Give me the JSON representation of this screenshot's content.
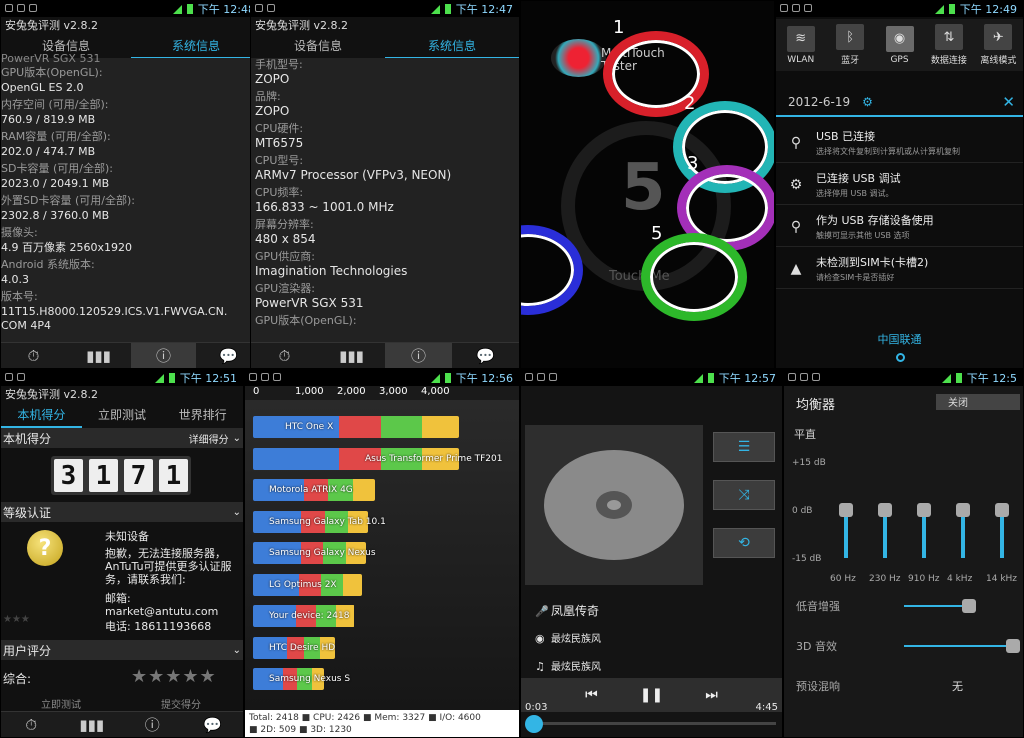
{
  "panel1": {
    "time": "下午 12:48",
    "app_title": "安兔兔评测 v2.8.2",
    "tabs": [
      "设备信息",
      "系统信息"
    ],
    "rows": [
      {
        "label": "GPU版本(OpenGL):",
        "value": "OpenGL ES 2.0"
      },
      {
        "label": "内存空间 (可用/全部):",
        "value": "760.9 / 819.9 MB"
      },
      {
        "label": "RAM容量 (可用/全部):",
        "value": "202.0 / 474.7 MB"
      },
      {
        "label": "SD卡容量 (可用/全部):",
        "value": "2023.0 / 2049.1 MB"
      },
      {
        "label": "外置SD卡容量 (可用/全部):",
        "value": "2302.8 / 3760.0 MB"
      },
      {
        "label": "摄像头:",
        "value": "4.9 百万像素    2560x1920"
      },
      {
        "label": "Android 系统版本:",
        "value": "4.0.3"
      },
      {
        "label": "版本号:",
        "value": "11T15.H8000.120529.ICS.V1.FWVGA.CN."
      }
    ],
    "top_clip": "PowerVR SGX 531",
    "bottom_clip": "COM 4P4"
  },
  "panel2": {
    "time": "下午 12:47",
    "app_title": "安兔兔评测 v2.8.2",
    "tabs": [
      "设备信息",
      "系统信息"
    ],
    "rows": [
      {
        "label": "手机型号:",
        "value": "ZOPO"
      },
      {
        "label": "品牌:",
        "value": "ZOPO"
      },
      {
        "label": "CPU硬件:",
        "value": "MT6575"
      },
      {
        "label": "CPU型号:",
        "value": "ARMv7 Processor (VFPv3, NEON)"
      },
      {
        "label": "CPU频率:",
        "value": "166.833 ~ 1001.0 MHz"
      },
      {
        "label": "屏幕分辨率:",
        "value": "480 x 854"
      },
      {
        "label": "GPU供应商:",
        "value": "Imagination Technologies"
      },
      {
        "label": "GPU渲染器:",
        "value": "PowerVR SGX 531"
      },
      {
        "label": "GPU版本(OpenGL):",
        "value": ""
      }
    ]
  },
  "panel3": {
    "logo": "MultiTouch Tester",
    "big_count": "5",
    "touch_label": "Touch Me",
    "labels": [
      "1",
      "2",
      "3",
      "5"
    ]
  },
  "panel4": {
    "time": "下午 12:49",
    "quick": [
      "WLAN",
      "蓝牙",
      "GPS",
      "数据连接",
      "离线模式"
    ],
    "date": "2012-6-19",
    "notifications": [
      {
        "title": "USB 已连接",
        "sub": "选择将文件复制到计算机或从计算机复制"
      },
      {
        "title": "已连接 USB 调试",
        "sub": "选择停用 USB 调试。"
      },
      {
        "title": "作为 USB 存储设备使用",
        "sub": "触摸可显示其他 USB 选项"
      },
      {
        "title": "未检测到SIM卡(卡槽2)",
        "sub": "请检查SIM卡是否插好"
      }
    ],
    "carrier": "中国联通"
  },
  "panel5": {
    "time": "下午 12:51",
    "app_title": "安兔兔评测 v2.8.2",
    "tabs": [
      "本机得分",
      "立即测试",
      "世界排行"
    ],
    "score_header": "本机得分",
    "detail": "详细得分",
    "digits": [
      "3",
      "1",
      "7",
      "1"
    ],
    "cert_header": "等级认证",
    "unknown": "未知设备",
    "desc": "抱歉，无法连接服务器，AnTuTu可提供更多认证服务，请联系我们:",
    "email": "邮箱: market@antutu.com",
    "phone": "电话: 18611193668",
    "rating_header": "用户评分",
    "overall": "综合:",
    "bottom_left": "立即测试",
    "bottom_right": "提交得分"
  },
  "panel6": {
    "time": "下午 12:56",
    "footer1": "Total: 2418 ■ CPU: 2426 ■ Mem: 3327 ■ I/O: 4600",
    "footer2": "■ 2D: 509 ■ 3D: 1230",
    "colors": {
      "cpu": "#3d7dd8",
      "mem": "#e04848",
      "io": "#5cc84a",
      "d2": "#f0c23c",
      "d3": "#f0c23c"
    }
  },
  "chart_data": {
    "type": "bar",
    "orientation": "horizontal",
    "x_ticks": [
      "0",
      "1,000",
      "2,000",
      "3,000",
      "4,000"
    ],
    "xlim": [
      0,
      5000
    ],
    "categories": [
      "HTC One X",
      "Asus Transformer Prime TF201",
      "Motorola ATRIX 4G",
      "Samsung Galaxy Tab 10.1",
      "Samsung Galaxy Nexus",
      "LG Optimus 2X",
      "Your device: 2418",
      "HTC Desire HD",
      "Samsung Nexus S"
    ],
    "totals": [
      4900,
      4900,
      2900,
      2750,
      2700,
      2600,
      2418,
      1950,
      1700
    ]
  },
  "panel7": {
    "time": "下午 12:57",
    "songs": [
      "凤凰传奇",
      "最炫民族风",
      "最炫民族风"
    ],
    "elapsed": "0:03",
    "duration": "4:45"
  },
  "panel8": {
    "time": "下午 12:5",
    "title": "均衡器",
    "toggle": "关闭",
    "preset": "平直",
    "db_top": "+15 dB",
    "db_mid": "0 dB",
    "db_bot": "-15 dB",
    "bands": [
      "60 Hz",
      "230 Hz",
      "910 Hz",
      "4 kHz",
      "14 kHz"
    ],
    "bass": "低音增强",
    "effect3d": "3D 音效",
    "reverb": "预设混响",
    "reverb_val": "无"
  }
}
